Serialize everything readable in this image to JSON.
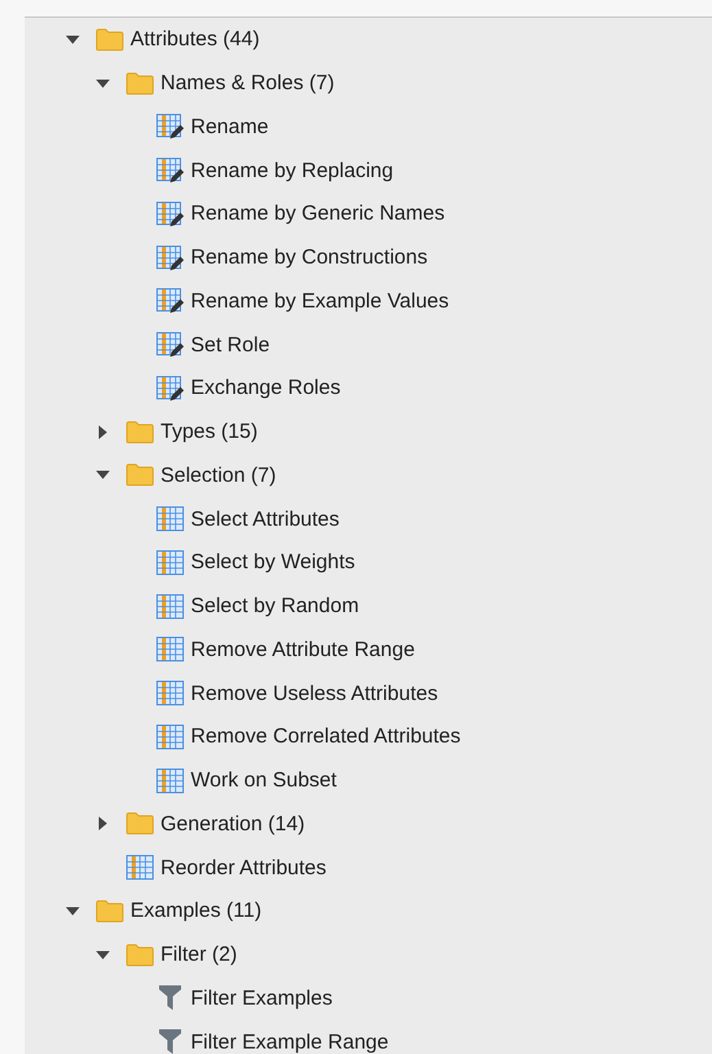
{
  "tree": [
    {
      "kind": "folder",
      "label": "Attributes (44)",
      "expanded": true,
      "children": [
        {
          "kind": "folder",
          "label": "Names & Roles (7)",
          "expanded": true,
          "children": [
            {
              "kind": "rename",
              "label": "Rename"
            },
            {
              "kind": "rename",
              "label": "Rename by Replacing"
            },
            {
              "kind": "rename",
              "label": "Rename by Generic Names"
            },
            {
              "kind": "rename",
              "label": "Rename by Constructions"
            },
            {
              "kind": "rename",
              "label": "Rename by Example Values"
            },
            {
              "kind": "rename",
              "label": "Set Role"
            },
            {
              "kind": "rename",
              "label": "Exchange Roles"
            }
          ]
        },
        {
          "kind": "folder",
          "label": "Types (15)",
          "expanded": false
        },
        {
          "kind": "folder",
          "label": "Selection (7)",
          "expanded": true,
          "children": [
            {
              "kind": "table",
              "label": "Select Attributes"
            },
            {
              "kind": "table",
              "label": "Select by Weights"
            },
            {
              "kind": "table",
              "label": "Select by Random"
            },
            {
              "kind": "table",
              "label": "Remove Attribute Range"
            },
            {
              "kind": "table",
              "label": "Remove Useless Attributes"
            },
            {
              "kind": "table",
              "label": "Remove Correlated Attributes"
            },
            {
              "kind": "table",
              "label": "Work on Subset"
            }
          ]
        },
        {
          "kind": "folder",
          "label": "Generation (14)",
          "expanded": false
        },
        {
          "kind": "table",
          "label": "Reorder Attributes"
        }
      ]
    },
    {
      "kind": "folder",
      "label": "Examples (11)",
      "expanded": true,
      "children": [
        {
          "kind": "folder",
          "label": "Filter (2)",
          "expanded": true,
          "children": [
            {
              "kind": "filter",
              "label": "Filter Examples"
            },
            {
              "kind": "filter",
              "label": "Filter Example Range"
            }
          ]
        }
      ]
    }
  ]
}
